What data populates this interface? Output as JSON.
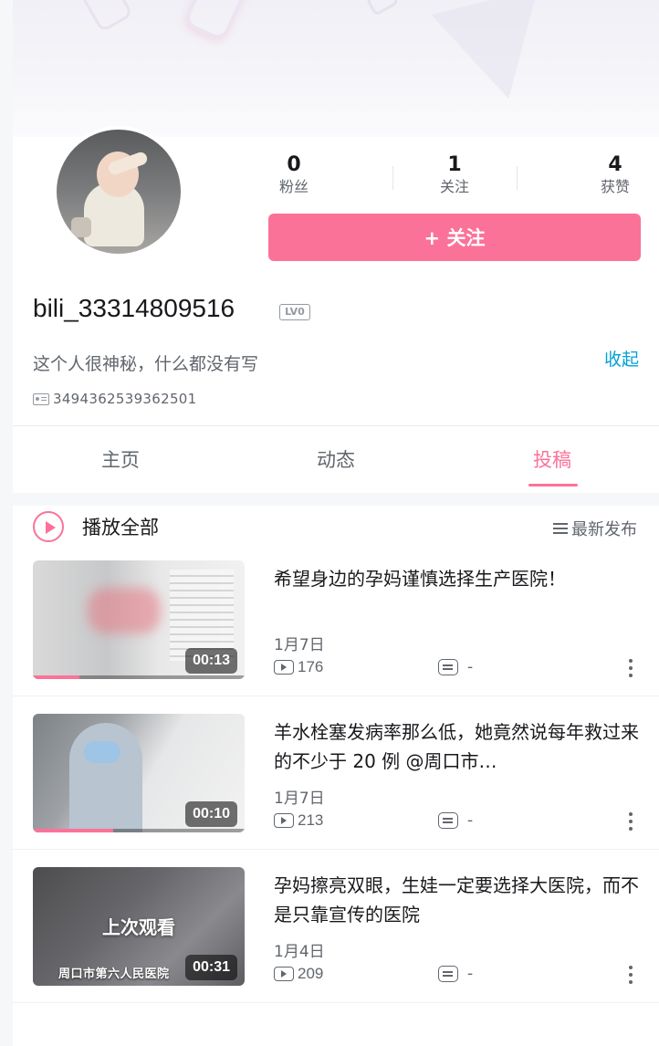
{
  "profile": {
    "username": "bili_33314809516",
    "level_badge": "LV0",
    "bio": "这个人很神秘，什么都没有写",
    "collapse_label": "收起",
    "uid": "3494362539362501"
  },
  "stats": [
    {
      "value": "0",
      "label": "粉丝"
    },
    {
      "value": "1",
      "label": "关注"
    },
    {
      "value": "4",
      "label": "获赞"
    }
  ],
  "follow_button": "+ 关注",
  "tabs": [
    {
      "label": "主页",
      "active": false
    },
    {
      "label": "动态",
      "active": false
    },
    {
      "label": "投稿",
      "active": true
    }
  ],
  "play_all": "播放全部",
  "sort_label": "最新发布",
  "videos": [
    {
      "title": "希望身边的孕妈谨慎选择生产医院！",
      "date": "1月7日",
      "plays": "176",
      "comments": "-",
      "duration": "00:13",
      "progress": 0.22
    },
    {
      "title": "羊水栓塞发病率那么低，她竟然说每年救过来的不少于 20 例 @周口市…",
      "date": "1月7日",
      "plays": "213",
      "comments": "-",
      "duration": "00:10",
      "progress": 0.38
    },
    {
      "title": "孕妈擦亮双眼，生娃一定要选择大医院，而不是只靠宣传的医院",
      "date": "1月4日",
      "plays": "209",
      "comments": "-",
      "duration": "00:31",
      "overlay_label": "上次观看",
      "caption": "周口市第六人民医院"
    }
  ],
  "colors": {
    "accent": "#fb7299",
    "link": "#00a1d6",
    "text_primary": "#18191c",
    "text_secondary": "#61666d"
  }
}
